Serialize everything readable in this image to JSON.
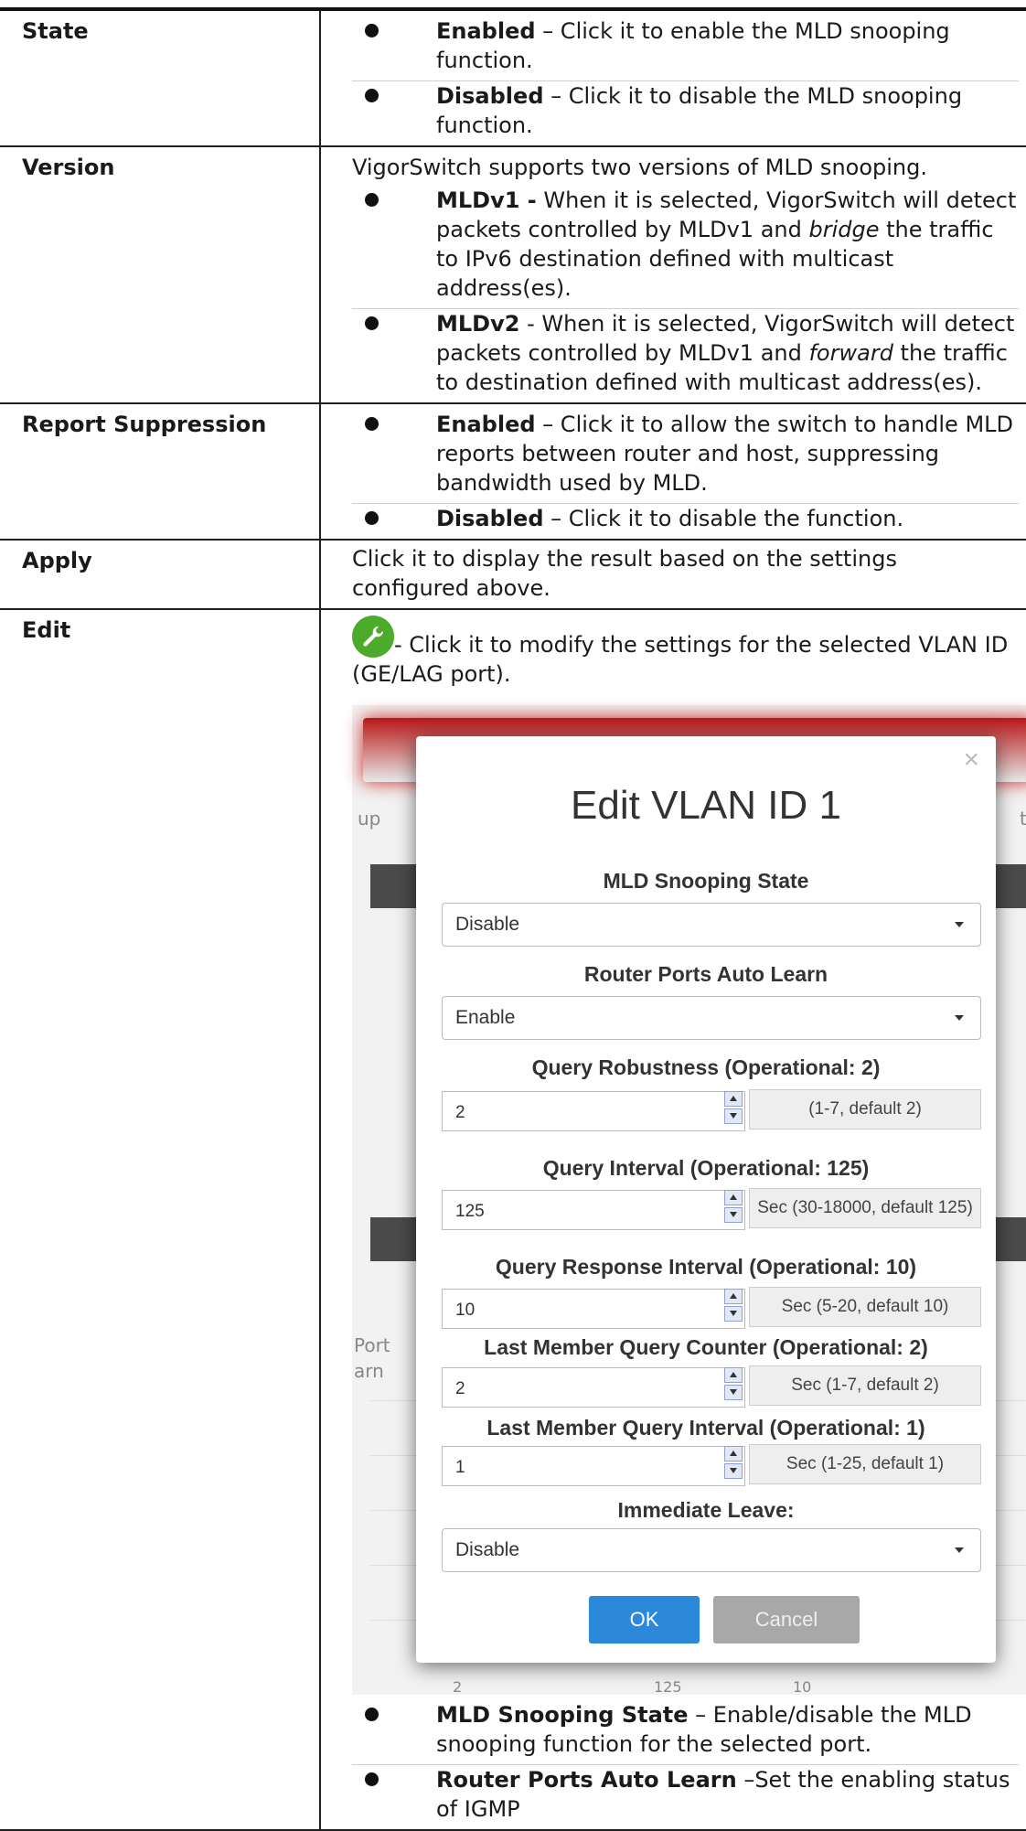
{
  "rows": {
    "state": {
      "label": "State",
      "items": [
        {
          "term": "Enabled",
          "text": " – Click it to enable the MLD snooping function."
        },
        {
          "term": "Disabled",
          "text": " – Click it to disable the MLD snooping function."
        }
      ]
    },
    "version": {
      "label": "Version",
      "intro": "VigorSwitch supports two versions of MLD snooping.",
      "items": [
        {
          "term": "MLDv1 -",
          "text_a": " When it is selected, VigorSwitch will detect packets controlled by MLDv1 and ",
          "em": "bridge",
          "text_b": " the traffic to IPv6 destination defined with multicast address(es)."
        },
        {
          "term": "MLDv2",
          "text_a": " - When it is selected, VigorSwitch will detect packets controlled by MLDv1 and ",
          "em": "forward",
          "text_b": " the traffic to destination defined with multicast address(es)."
        }
      ]
    },
    "report": {
      "label": "Report Suppression",
      "items": [
        {
          "term": "Enabled",
          "text": " – Click it to allow the switch to handle MLD reports between router and host, suppressing bandwidth used by MLD."
        },
        {
          "term": "Disabled",
          "text": " – Click it to disable the function."
        }
      ]
    },
    "apply": {
      "label": "Apply",
      "text": "Click it to display the result based on the settings configured above."
    },
    "edit": {
      "label": "Edit",
      "icon": "wrench-icon",
      "text": "- Click it to modify the settings for the selected VLAN ID (GE/LAG port).",
      "after_items": [
        {
          "term": "MLD Snooping State",
          "text": " – Enable/disable the MLD snooping function for the selected port."
        },
        {
          "term": "Router Ports Auto Learn",
          "text": " –Set the enabling status of IGMP"
        }
      ]
    }
  },
  "dialog": {
    "title": "Edit VLAN ID 1",
    "close_glyph": "×",
    "bg_fragments": {
      "left_tab": "up",
      "right_tab": "te",
      "col_a": "Port",
      "col_b": "arn",
      "row_a": "2",
      "row_b": "125",
      "row_c": "10"
    },
    "snooping_state": {
      "label": "MLD Snooping State",
      "value": "Disable"
    },
    "auto_learn": {
      "label": "Router Ports Auto Learn",
      "value": "Enable"
    },
    "robustness": {
      "label": "Query Robustness (Operational: 2)",
      "value": "2",
      "hint": "(1-7, default 2)"
    },
    "query_interval": {
      "label": "Query Interval (Operational: 125)",
      "value": "125",
      "hint": "Sec (30-18000, default 125)"
    },
    "response_interval": {
      "label": "Query Response Interval (Operational: 10)",
      "value": "10",
      "hint": "Sec (5-20, default 10)"
    },
    "lmq_counter": {
      "label": "Last Member Query Counter (Operational: 2)",
      "value": "2",
      "hint": "Sec (1-7, default 2)"
    },
    "lmq_interval": {
      "label": "Last Member Query Interval (Operational: 1)",
      "value": "1",
      "hint": "Sec (1-25, default 1)"
    },
    "immediate_leave": {
      "label": "Immediate Leave:",
      "value": "Disable"
    },
    "ok_label": "OK",
    "cancel_label": "Cancel"
  }
}
